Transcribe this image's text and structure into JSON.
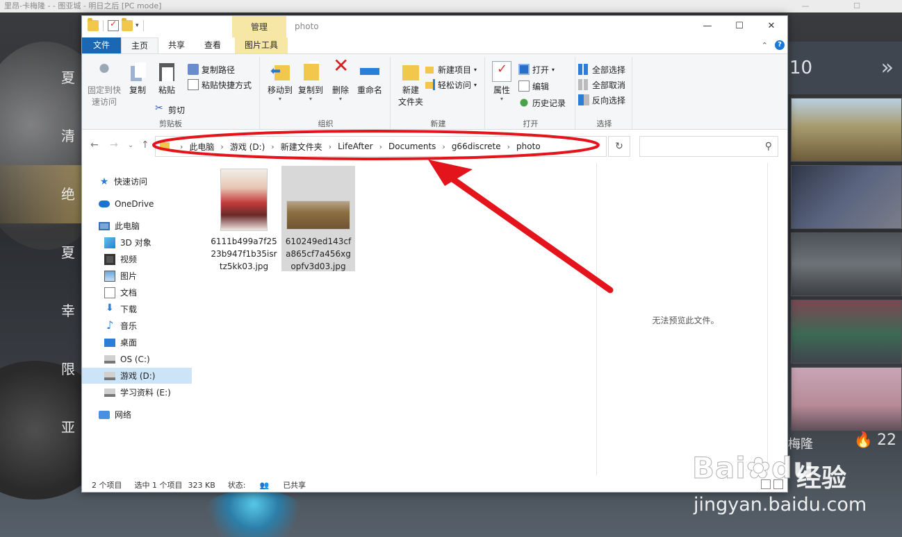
{
  "game": {
    "title_bar": "里昂-卡梅隆 - - 图亚城 - 明日之后 [PC mode]",
    "menu_items": [
      "夏",
      "清",
      "绝",
      "夏",
      "幸",
      "限",
      "亚"
    ],
    "active_menu_index": 2,
    "right_panel_header": "10",
    "right_panel_chevron": "»",
    "right_bottom_name": "梅隆",
    "right_bottom_likes": "22"
  },
  "explorer": {
    "window_title": "photo",
    "context_tab": "管理",
    "window_controls": {
      "minimize": "—",
      "maximize": "☐",
      "close": "✕"
    },
    "ribbon_tabs": {
      "file": "文件",
      "home": "主页",
      "share": "共享",
      "view": "查看",
      "picture_tools": "图片工具"
    },
    "ribbon_right": {
      "collapse": "⌃",
      "help": "?"
    },
    "ribbon": {
      "clipboard": {
        "label": "剪贴板",
        "pin": "固定到快\n速访问",
        "copy": "复制",
        "paste": "粘贴",
        "copy_path": "复制路径",
        "paste_shortcut": "粘贴快捷方式",
        "cut": "剪切"
      },
      "organize": {
        "label": "组织",
        "move_to": "移动到",
        "copy_to": "复制到",
        "delete": "删除",
        "rename": "重命名"
      },
      "new": {
        "label": "新建",
        "new_folder": "新建\n文件夹",
        "new_item": "新建项目",
        "easy_access": "轻松访问"
      },
      "open": {
        "label": "打开",
        "properties": "属性",
        "open": "打开",
        "edit": "编辑",
        "history": "历史记录"
      },
      "select": {
        "label": "选择",
        "select_all": "全部选择",
        "select_none": "全部取消",
        "invert": "反向选择"
      }
    },
    "nav_buttons": {
      "back": "←",
      "forward": "→",
      "recent": "⌄",
      "up": "↑"
    },
    "address": {
      "crumbs": [
        "此电脑",
        "游戏 (D:)",
        "新建文件夹",
        "LifeAfter",
        "Documents",
        "g66discrete",
        "photo"
      ],
      "refresh": "↻"
    },
    "search": {
      "icon": "search-icon",
      "glyph": "⚲"
    },
    "nav_pane": {
      "quick_access": "快速访问",
      "onedrive": "OneDrive",
      "this_pc": "此电脑",
      "objects3d": "3D 对象",
      "videos": "视频",
      "pictures": "图片",
      "documents": "文档",
      "downloads": "下载",
      "music": "音乐",
      "desktop": "桌面",
      "drive_c": "OS (C:)",
      "drive_d": "游戏 (D:)",
      "drive_e": "学习资料 (E:)",
      "network": "网络"
    },
    "files": [
      {
        "name": "6111b499a7f2523b947f1b35isrtz5kk03.jpg",
        "selected": false
      },
      {
        "name": "610249ed143cfa865cf7a456xgopfv3d03.jpg",
        "selected": true
      }
    ],
    "preview_message": "无法预览此文件。",
    "status": {
      "item_count": "2 个项目",
      "selection": "选中 1 个项目",
      "size": "323 KB",
      "state_label": "状态:",
      "state_value": "已共享"
    }
  },
  "annotation": {
    "color": "#e3141b"
  },
  "watermark": {
    "logo": "Bai",
    "logo_tail": "du",
    "cn": "经验",
    "url": "jingyan.baidu.com"
  }
}
